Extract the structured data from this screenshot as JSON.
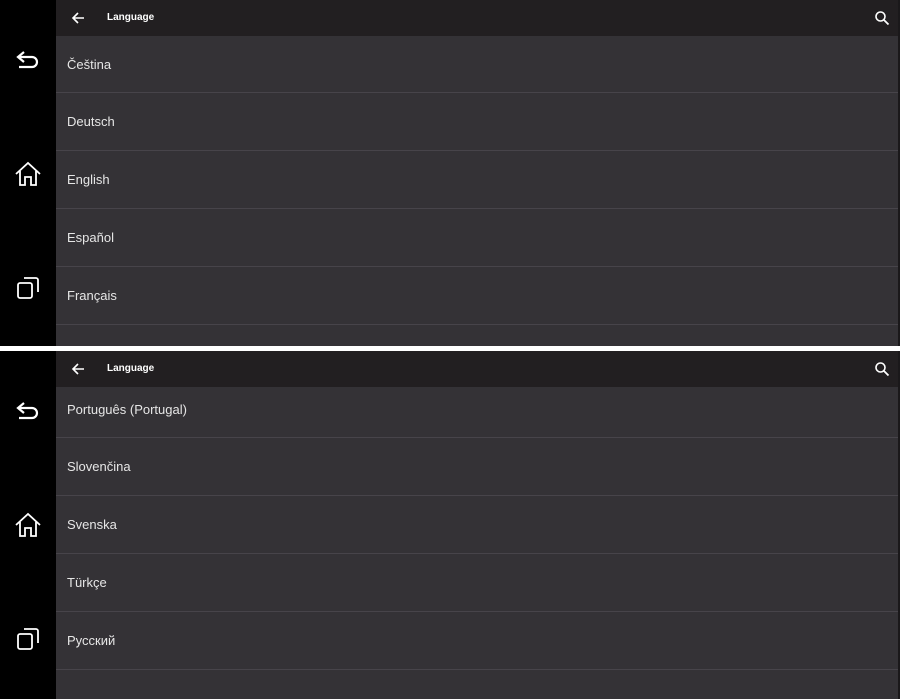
{
  "screens": [
    {
      "header": {
        "title": "Language"
      },
      "languages": [
        "Čeština",
        "Deutsch",
        "English",
        "Español",
        "Français"
      ]
    },
    {
      "header": {
        "title": "Language"
      },
      "languages": [
        "Português (Portugal)",
        "Slovenčina",
        "Svenska",
        "Türkçe",
        "Русский"
      ]
    }
  ],
  "icons": {
    "nav_back": "undo-arrow-icon",
    "nav_home": "home-icon",
    "nav_recents": "recents-icon",
    "header_back": "arrow-left-icon",
    "header_search": "search-icon"
  },
  "colors": {
    "background": "#343236",
    "header": "#221f21",
    "navbar": "#000000",
    "divider": "#47444a",
    "text": "#e6e6e6"
  }
}
